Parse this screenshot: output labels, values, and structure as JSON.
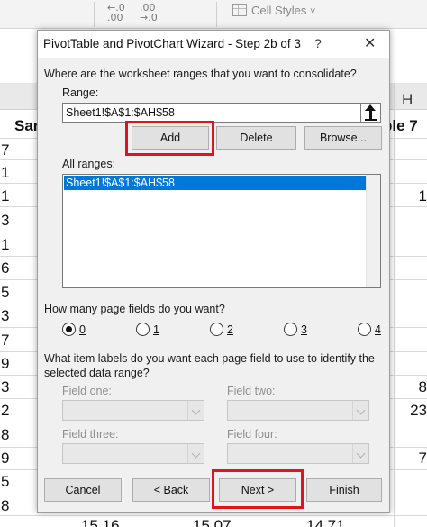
{
  "spreadsheet": {
    "ribbon": {
      "decrease_decimal_icon": "←.0\n.00",
      "increase_decimal_icon": ".00\n→.0",
      "cell_styles_label": "Cell Styles",
      "cell_styles_chevron": "˅"
    },
    "column_header_h": "H",
    "header_left_partial": "Sar",
    "header_right_partial": "ple 7",
    "left_column_values": [
      "7",
      "1",
      "1",
      "3",
      "1",
      "6",
      "5",
      "3",
      "7",
      "9",
      "3",
      "2",
      "8",
      "9",
      "5",
      "8"
    ],
    "right_column_values": [
      "1",
      "8",
      "23",
      "7"
    ],
    "bottom_row_values": [
      "15.16",
      "15.07",
      "14.71"
    ]
  },
  "dialog": {
    "title": "PivotTable and PivotChart Wizard - Step 2b of 3",
    "help_label": "?",
    "close_label": "✕",
    "question": "Where are the worksheet ranges that you want to consolidate?",
    "range_label": "Range:",
    "range_value": "Sheet1!$A$1:$AH$58",
    "collapse_icon": "up-arrow",
    "add_label": "Add",
    "delete_label": "Delete",
    "browse_label": "Browse...",
    "all_ranges_label": "All ranges:",
    "all_ranges": [
      "Sheet1!$A$1:$AH$58"
    ],
    "page_fields_question": "How many page fields do you want?",
    "page_field_options": [
      "0",
      "1",
      "2",
      "3",
      "4"
    ],
    "page_field_selected": "0",
    "item_labels_question_line1": "What item labels do you want each page field to use to identify the",
    "item_labels_question_line2": "selected data range?",
    "field_one_label": "Field one:",
    "field_two_label": "Field two:",
    "field_three_label": "Field three:",
    "field_four_label": "Field four:",
    "cancel_label": "Cancel",
    "back_label": "< Back",
    "next_label": "Next >",
    "finish_label": "Finish",
    "highlight_color": "#e0141b",
    "selection_color": "#0078d7"
  }
}
